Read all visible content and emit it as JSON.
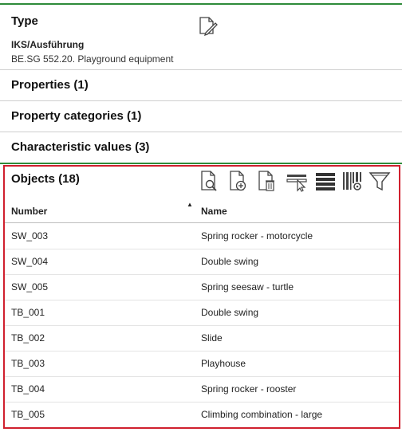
{
  "type_section": {
    "title": "Type",
    "name": "IKS/Ausführung",
    "description": "BE.SG 552.20. Playground equipment",
    "edit_icon": "document-edit-icon"
  },
  "sections": [
    {
      "title": "Properties (1)"
    },
    {
      "title": "Property categories (1)"
    },
    {
      "title": "Characteristic values (3)"
    }
  ],
  "objects": {
    "title": "Objects (18)",
    "toolbar_icons": [
      "document-search-icon",
      "document-add-icon",
      "document-delete-icon",
      "select-cursor-icon",
      "list-lines-icon",
      "barcode-settings-icon",
      "filter-icon"
    ],
    "columns": [
      "Number",
      "Name"
    ],
    "sorted_column": "Number",
    "sort_direction": "ascending",
    "rows": [
      {
        "number": "SW_003",
        "name": "Spring rocker - motorcycle"
      },
      {
        "number": "SW_004",
        "name": "Double swing"
      },
      {
        "number": "SW_005",
        "name": "Spring seesaw - turtle"
      },
      {
        "number": "TB_001",
        "name": "Double swing"
      },
      {
        "number": "TB_002",
        "name": "Slide"
      },
      {
        "number": "TB_003",
        "name": "Playhouse"
      },
      {
        "number": "TB_004",
        "name": "Spring rocker - rooster"
      },
      {
        "number": "TB_005",
        "name": "Climbing combination - large"
      }
    ]
  },
  "colors": {
    "section_separator": "#2e8b3a",
    "objects_border": "#d0202e"
  }
}
